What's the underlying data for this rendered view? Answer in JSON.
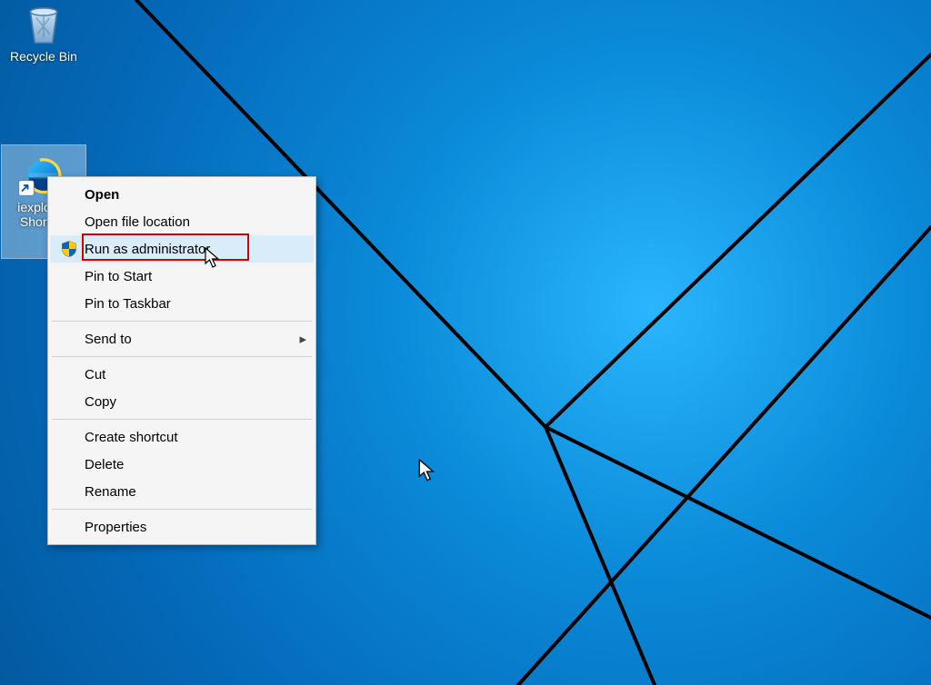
{
  "desktop": {
    "icons": {
      "recycle_bin": {
        "label": "Recycle Bin"
      },
      "iexplore": {
        "label": "iexplore - Shortcut"
      }
    }
  },
  "context_menu": {
    "items": [
      {
        "label": "Open",
        "default": true
      },
      {
        "label": "Open file location"
      },
      {
        "label": "Run as administrator",
        "shield": true,
        "hover": true,
        "highlight": true
      },
      {
        "label": "Pin to Start"
      },
      {
        "label": "Pin to Taskbar"
      }
    ],
    "items2": [
      {
        "label": "Send to",
        "submenu": true
      }
    ],
    "items3": [
      {
        "label": "Cut"
      },
      {
        "label": "Copy"
      }
    ],
    "items4": [
      {
        "label": "Create shortcut"
      },
      {
        "label": "Delete"
      },
      {
        "label": "Rename"
      }
    ],
    "items5": [
      {
        "label": "Properties"
      }
    ]
  }
}
